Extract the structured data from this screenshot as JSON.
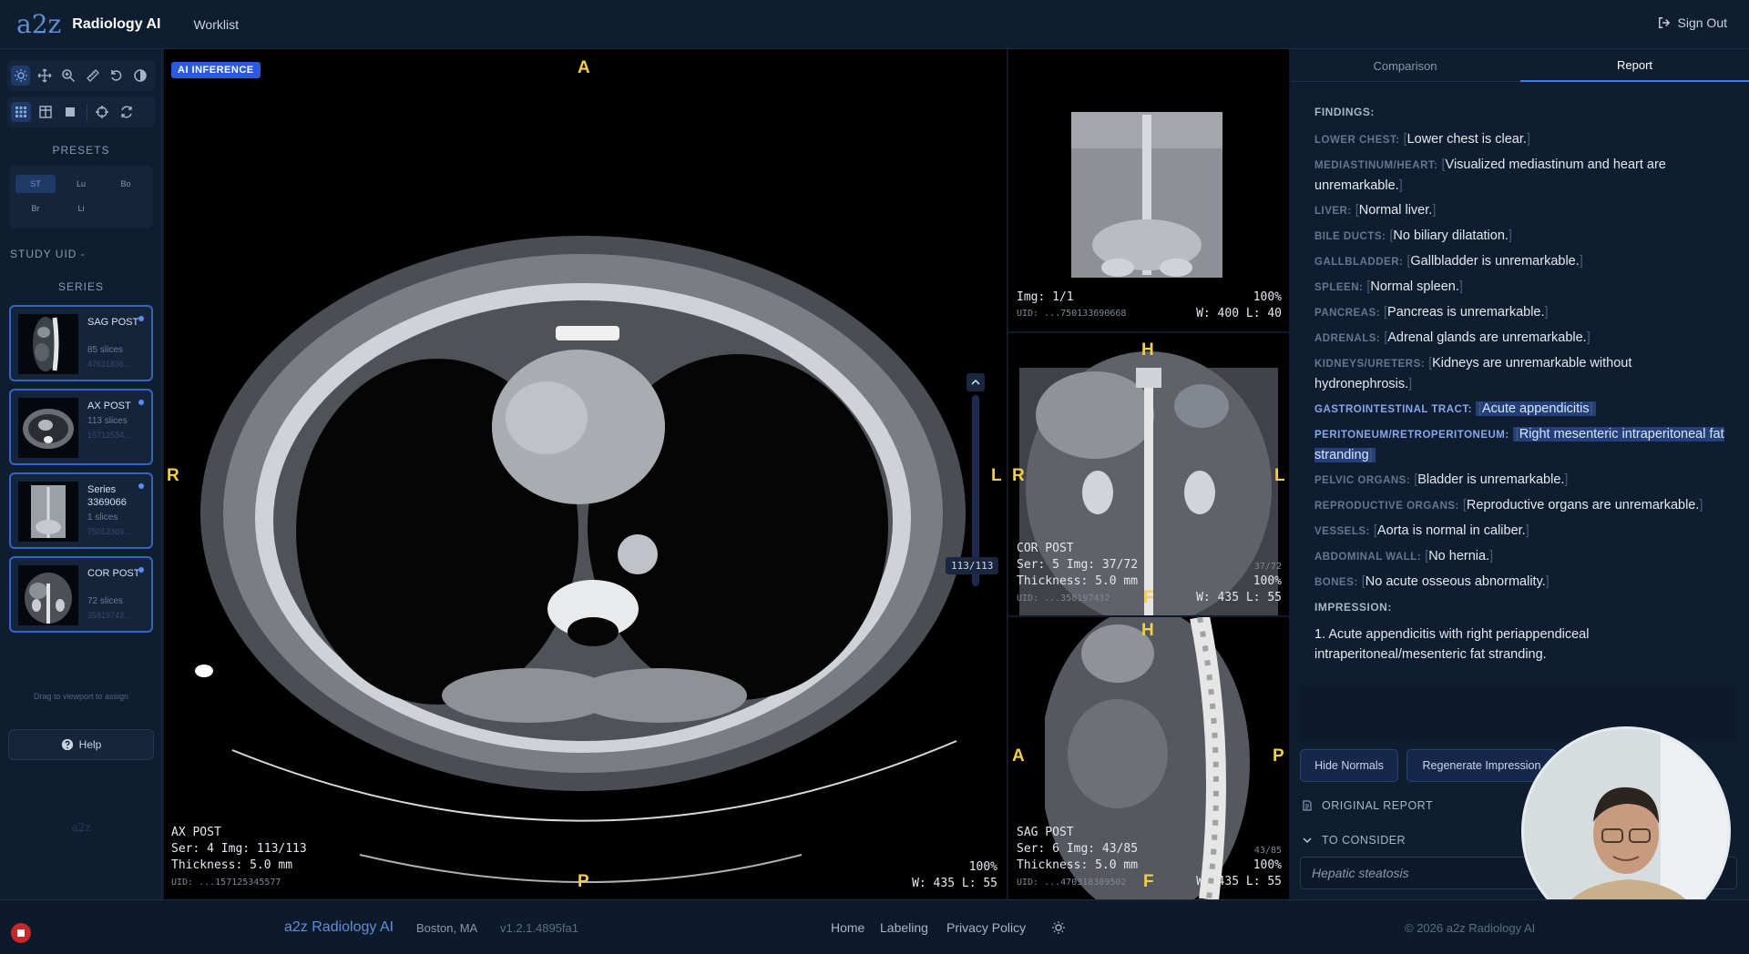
{
  "header": {
    "logo": "a2z",
    "brand": "Radiology AI",
    "nav_worklist": "Worklist",
    "sign_out": "Sign Out"
  },
  "sidebar": {
    "presets_label": "PRESETS",
    "presets": [
      "ST",
      "Lu",
      "Bo",
      "Br",
      "Li"
    ],
    "study_uid_label": "STUDY UID -",
    "series_label": "SERIES",
    "series": [
      {
        "name": "SAG POST",
        "slices": "85 slices",
        "id": "47631836..."
      },
      {
        "name": "AX POST",
        "slices": "113 slices",
        "id": "15712534..."
      },
      {
        "name": "Series 3369066",
        "slices": "1 slices",
        "id": "75013369..."
      },
      {
        "name": "COR POST",
        "slices": "72 slices",
        "id": "35819743..."
      }
    ],
    "drag_hint": "Drag to viewport to assign",
    "help": "Help",
    "bottom_logo": "a2z"
  },
  "viewports": {
    "main": {
      "badge": "AI INFERENCE",
      "orient_top": "A",
      "orient_left": "R",
      "orient_right": "L",
      "orient_bottom": "P",
      "series": "AX POST",
      "ser_img": "Ser: 4 Img: 113/113",
      "thickness": "Thickness: 5.0 mm",
      "uid": "UID: ...157125345577",
      "zoom": "100%",
      "wl": "W: 435 L: 55",
      "slice_counter": "113/113"
    },
    "top_right": {
      "img": "Img: 1/1",
      "uid": "UID: ...750133690668",
      "zoom": "100%",
      "wl": "W: 400 L: 40"
    },
    "mid_right": {
      "orient_top": "H",
      "orient_left": "R",
      "orient_right": "L",
      "orient_bottom": "F",
      "series": "COR POST",
      "ser_img": "Ser: 5 Img: 37/72",
      "thickness": "Thickness: 5.0 mm",
      "uid": "UID: ...358197432",
      "zoom": "100%",
      "wl": "W: 435 L: 55",
      "counter": "37/72"
    },
    "bottom_right": {
      "orient_top": "H",
      "orient_left": "A",
      "orient_right": "P",
      "orient_bottom": "F",
      "series": "SAG POST",
      "ser_img": "Ser: 6 Img: 43/85",
      "thickness": "Thickness: 5.0 mm",
      "uid": "UID: ...470318389502",
      "zoom": "100%",
      "wl": "W: 435 L: 55",
      "counter": "43/85"
    }
  },
  "report_panel": {
    "tabs": [
      "Comparison",
      "Report"
    ],
    "findings_label": "FINDINGS:",
    "findings": [
      {
        "label": "LOWER CHEST:",
        "text": "Lower chest is clear."
      },
      {
        "label": "MEDIASTINUM/HEART:",
        "text": "Visualized mediastinum and heart are unremarkable."
      },
      {
        "label": "LIVER:",
        "text": "Normal liver."
      },
      {
        "label": "BILE DUCTS:",
        "text": "No biliary dilatation."
      },
      {
        "label": "GALLBLADDER:",
        "text": "Gallbladder is unremarkable."
      },
      {
        "label": "SPLEEN:",
        "text": "Normal spleen."
      },
      {
        "label": "PANCREAS:",
        "text": "Pancreas is unremarkable."
      },
      {
        "label": "ADRENALS:",
        "text": "Adrenal glands are unremarkable."
      },
      {
        "label": "KIDNEYS/URETERS:",
        "text": "Kidneys are unremarkable without hydronephrosis."
      },
      {
        "label": "GASTROINTESTINAL TRACT:",
        "text": "Acute appendicitis",
        "abnormal": true
      },
      {
        "label": "PERITONEUM/RETROPERITONEUM:",
        "text": "Right mesenteric intraperitoneal fat stranding",
        "abnormal": true
      },
      {
        "label": "PELVIC ORGANS:",
        "text": "Bladder is unremarkable."
      },
      {
        "label": "REPRODUCTIVE ORGANS:",
        "text": "Reproductive organs are unremarkable."
      },
      {
        "label": "VESSELS:",
        "text": "Aorta is normal in caliber."
      },
      {
        "label": "ABDOMINAL WALL:",
        "text": "No hernia."
      },
      {
        "label": "BONES:",
        "text": "No acute osseous abnormality."
      }
    ],
    "impression_label": "IMPRESSION:",
    "impression_text": "1. Acute appendicitis with right periappendiceal intraperitoneal/mesenteric fat stranding.",
    "hide_normals": "Hide Normals",
    "regenerate": "Regenerate Impression",
    "original_report": "ORIGINAL REPORT",
    "to_consider": "TO CONSIDER",
    "consider_value": "Hepatic steatosis"
  },
  "footer": {
    "brand": "a2z Radiology AI",
    "location": "Boston, MA",
    "version": "v1.2.1.4895fa1",
    "links": [
      "Home",
      "Labeling",
      "Privacy Policy"
    ],
    "copyright": "© 2026 a2z Radiology AI"
  }
}
